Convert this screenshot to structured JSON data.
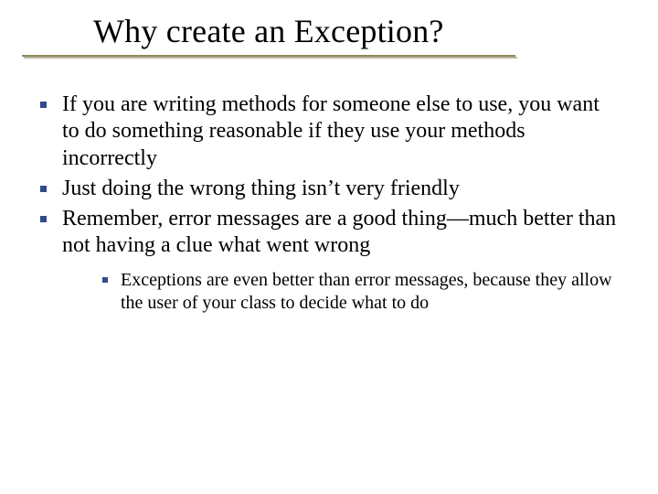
{
  "title": "Why create an Exception?",
  "bullets": {
    "level1": [
      "If you are writing methods for someone else to use, you want to do something reasonable if they use your methods incorrectly",
      "Just doing the wrong thing isn’t very friendly",
      "Remember, error messages are a good thing—much better than not having a clue what went wrong"
    ],
    "level2": [
      "Exceptions are even better than error messages, because they allow the user of your class to decide what to do"
    ]
  }
}
